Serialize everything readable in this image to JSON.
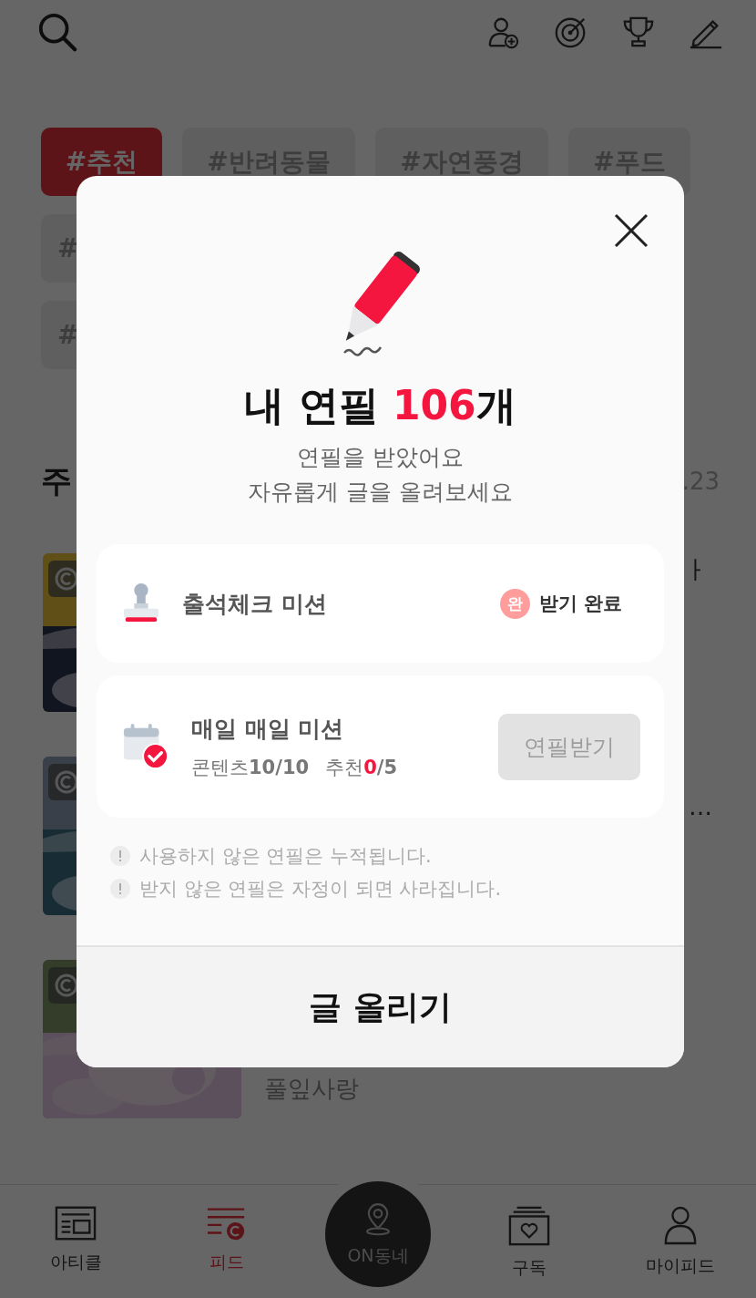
{
  "tag_rows": [
    [
      {
        "label": "#추천",
        "selected": true
      },
      {
        "label": "#반려동물",
        "selected": false
      },
      {
        "label": "#자연풍경",
        "selected": false
      },
      {
        "label": "#푸드",
        "selected": false
      }
    ],
    [
      {
        "label": "#",
        "selected": false
      }
    ],
    [
      {
        "label": "#",
        "selected": false
      }
    ]
  ],
  "section": {
    "title": "주",
    "date": ".23"
  },
  "feed": [
    {
      "kind": "picture",
      "title_fragment": "ㅏ"
    },
    {
      "kind": "picture",
      "more": "…"
    },
    {
      "kind": "picture",
      "author": "풀잎사랑"
    }
  ],
  "modal": {
    "title_prefix": "내 연필 ",
    "count": "106",
    "title_suffix": "개",
    "message": [
      "연필을 받았어요",
      "자유롭게 글을 올려보세요"
    ],
    "missions": [
      {
        "kind": "attendance",
        "title": "출석체크 미션",
        "badge": "완",
        "status": "받기 완료"
      },
      {
        "kind": "daily",
        "title": "매일 매일 미션",
        "progress": [
          {
            "label": "콘텐츠",
            "done": "10",
            "total": "/10",
            "complete": true
          },
          {
            "label": "추천",
            "done": "0",
            "total": "/5",
            "complete": false
          }
        ],
        "button": {
          "label": "연필받기",
          "disabled": true
        }
      }
    ],
    "notes": [
      "사용하지 않은 연필은 누적됩니다.",
      "받지 않은 연필은 자정이 되면 사라집니다."
    ],
    "primary_button": "글 올리기"
  },
  "nav": [
    {
      "kind": "article",
      "label": "아티클",
      "selected": false
    },
    {
      "kind": "feed",
      "label": "피드",
      "selected": true
    },
    {
      "kind": "center",
      "label": "ON동네",
      "selected": false
    },
    {
      "kind": "subscribe",
      "label": "구독",
      "selected": false
    },
    {
      "kind": "profile",
      "label": "마이피드",
      "selected": false
    }
  ]
}
